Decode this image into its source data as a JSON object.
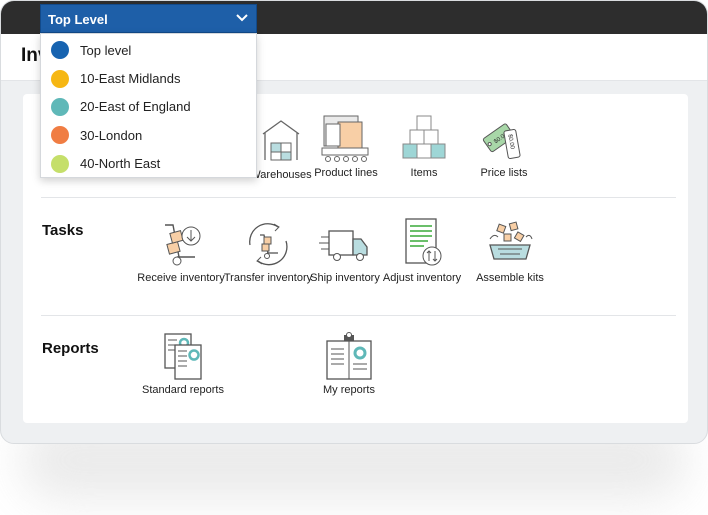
{
  "page": {
    "title": "Inventory"
  },
  "dropdown": {
    "selected": "Top Level",
    "options": [
      {
        "label": "Top level",
        "color": "#1763b0"
      },
      {
        "label": "10-East Midlands",
        "color": "#f6b713"
      },
      {
        "label": "20-East of England",
        "color": "#5fb8b8"
      },
      {
        "label": "30-London",
        "color": "#f07d43"
      },
      {
        "label": "40-North East",
        "color": "#c5df6a"
      }
    ]
  },
  "sections": {
    "setup": {
      "tiles": [
        {
          "label": "Warehouses",
          "icon": "warehouse-icon"
        },
        {
          "label": "Product lines",
          "icon": "product-lines-icon"
        },
        {
          "label": "Items",
          "icon": "items-boxes-icon"
        },
        {
          "label": "Price lists",
          "icon": "price-tag-icon"
        }
      ]
    },
    "tasks": {
      "label": "Tasks",
      "tiles": [
        {
          "label": "Receive inventory",
          "icon": "receive-inventory-icon"
        },
        {
          "label": "Transfer inventory",
          "icon": "transfer-inventory-icon"
        },
        {
          "label": "Ship inventory",
          "icon": "ship-truck-icon"
        },
        {
          "label": "Adjust inventory",
          "icon": "adjust-inventory-icon"
        },
        {
          "label": "Assemble kits",
          "icon": "assemble-kits-icon"
        }
      ]
    },
    "reports": {
      "label": "Reports",
      "tiles": [
        {
          "label": "Standard reports",
          "icon": "standard-reports-icon"
        },
        {
          "label": "My reports",
          "icon": "my-reports-icon"
        }
      ]
    }
  }
}
